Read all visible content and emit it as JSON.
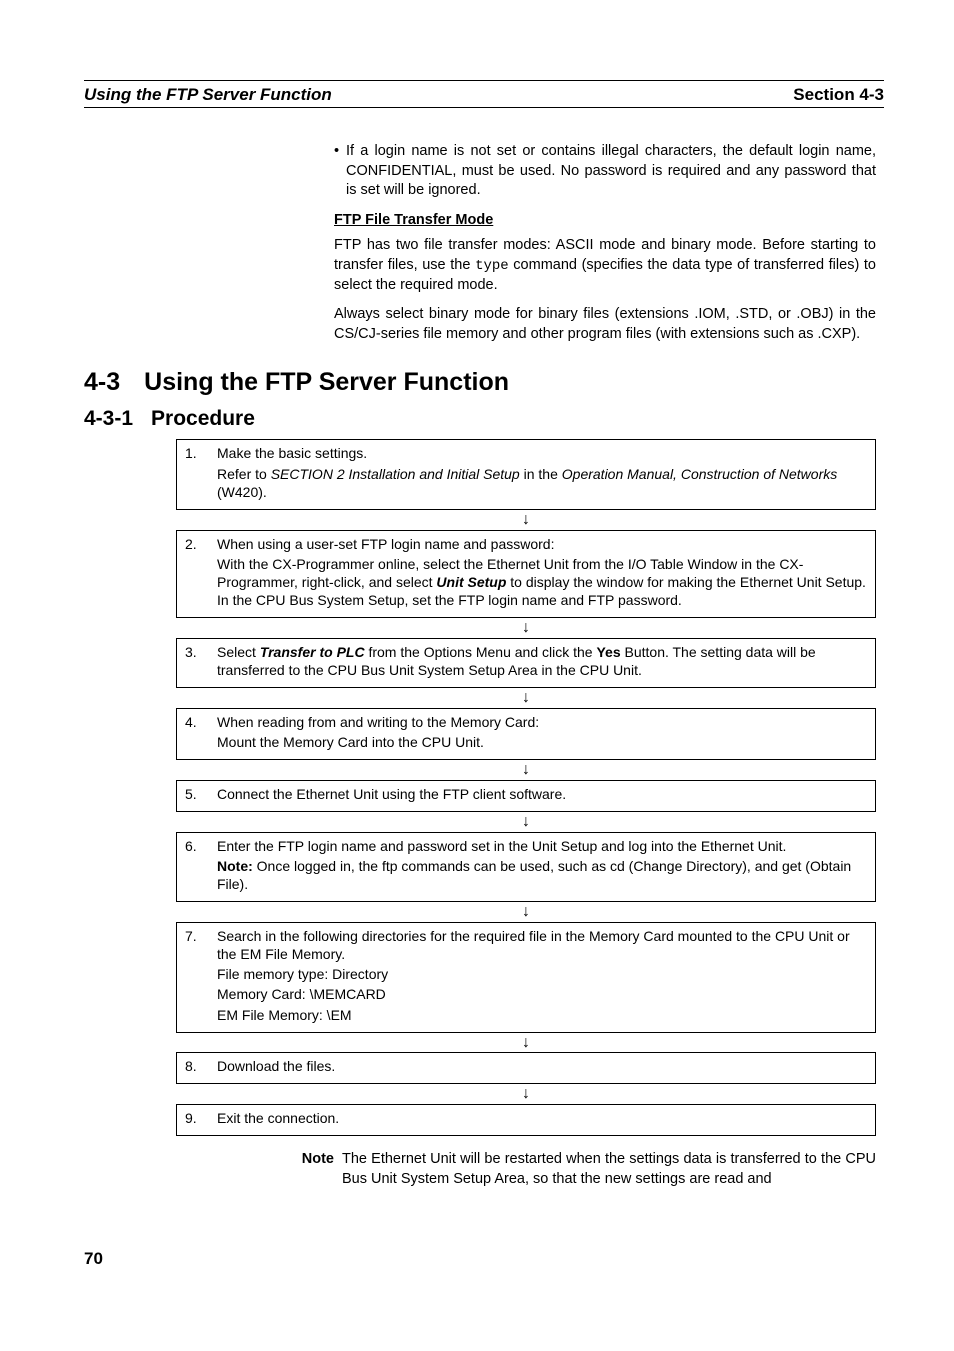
{
  "header": {
    "left": "Using the FTP Server Function",
    "right": "Section 4-3"
  },
  "intro": {
    "bullet": "If a login name is not set or contains illegal characters, the default login name, CONFIDENTIAL, must be used. No password is required and any password that is set will be ignored.",
    "sub_heading": "FTP File Transfer Mode",
    "para1_a": "FTP has two file transfer modes: ASCII mode and binary mode. Before starting to transfer files, use the ",
    "para1_cmd": "type",
    "para1_b": " command (specifies the data type of transferred files) to select the required mode.",
    "para2": "Always select binary mode for binary files (extensions .IOM, .STD, or .OBJ) in the CS/CJ-series file memory and other program files (with extensions such as .CXP)."
  },
  "h1": {
    "num": "4-3",
    "title": "Using the FTP Server Function"
  },
  "h2": {
    "num": "4-3-1",
    "title": "Procedure"
  },
  "steps": [
    {
      "n": "1.",
      "lines": [
        {
          "t": "Make the basic settings."
        },
        {
          "html": "Refer to <span class='ital'>SECTION 2 Installation and Initial Setup</span> in the <span class='ital'>Operation Manual, Construction of Networks</span> (W420)."
        }
      ]
    },
    {
      "n": "2.",
      "lines": [
        {
          "t": "When using a user-set FTP login name and password:"
        },
        {
          "html": "With the CX-Programmer online, select the Ethernet Unit from the I/O Table Window in the CX-Programmer, right-click, and select <span class='bolditalic'>Unit Setup</span> to display the window for making the Ethernet Unit Setup. In the CPU Bus System Setup, set the FTP login name and FTP password."
        }
      ]
    },
    {
      "n": "3.",
      "lines": [
        {
          "html": "Select <span class='bolditalic'>Transfer to PLC</span> from the Options Menu and click the <span class='bold'>Yes</span> Button. The setting data will be transferred to the CPU Bus Unit System Setup Area in the CPU Unit."
        }
      ]
    },
    {
      "n": "4.",
      "lines": [
        {
          "t": "When reading from and writing to the Memory Card:"
        },
        {
          "t": "Mount the Memory Card into the CPU Unit."
        }
      ]
    },
    {
      "n": "5.",
      "lines": [
        {
          "t": "Connect the Ethernet Unit using the FTP client software."
        }
      ]
    },
    {
      "n": "6.",
      "lines": [
        {
          "t": "Enter the FTP login name and password set in the Unit Setup and log into the Ethernet Unit."
        },
        {
          "html": "<span class='bold'>Note:</span> Once logged in, the ftp commands can be used, such as cd (Change Directory), and get (Obtain File)."
        }
      ]
    },
    {
      "n": "7.",
      "lines": [
        {
          "t": "Search in the following directories for the required file in the Memory Card mounted to the CPU Unit or the EM File Memory."
        },
        {
          "t": "File memory type: Directory"
        },
        {
          "t": "Memory Card: \\MEMCARD"
        },
        {
          "t": "EM File Memory:  \\EM"
        }
      ]
    },
    {
      "n": "8.",
      "lines": [
        {
          "t": "Download the files."
        }
      ]
    },
    {
      "n": "9.",
      "lines": [
        {
          "t": "Exit the connection."
        }
      ]
    }
  ],
  "note": {
    "label": "Note",
    "text": "The Ethernet Unit will be restarted when the settings data is transferred to the CPU Bus Unit System Setup Area, so that the new settings are read and"
  },
  "page_number": "70",
  "arrow": "↓"
}
